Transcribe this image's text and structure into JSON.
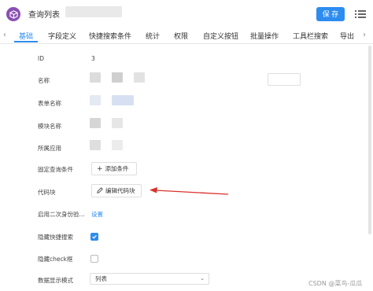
{
  "header": {
    "title": "查询列表",
    "save_label": "保 存"
  },
  "tabs": [
    "基础",
    "字段定义",
    "快捷搜索条件",
    "统计",
    "权限",
    "自定义按钮",
    "批量操作",
    "工具栏搜索",
    "导出"
  ],
  "form": {
    "id_label": "ID",
    "id_value": "3",
    "name_label": "名称",
    "table_name_label": "表单名称",
    "module_name_label": "模块名称",
    "app_label": "所属应用",
    "fixed_query_label": "固定查询条件",
    "add_condition_label": "添加条件",
    "code_block_label": "代码块",
    "edit_code_label": "编辑代码块",
    "enable_second_auth_label": "启用二次身份验...",
    "settings_link": "设置",
    "hide_quick_search_label": "隐藏快捷搜索",
    "hide_quick_search_checked": true,
    "hide_check_label": "隐藏check框",
    "hide_check_checked": false,
    "display_mode_label": "数据显示模式",
    "display_mode_value": "列表"
  },
  "watermark": "CSDN @菜鸟-瓜瓜",
  "colors": {
    "accent": "#2d8cf0",
    "app_icon": "#8a4fb3",
    "arrow": "#d9312c"
  }
}
